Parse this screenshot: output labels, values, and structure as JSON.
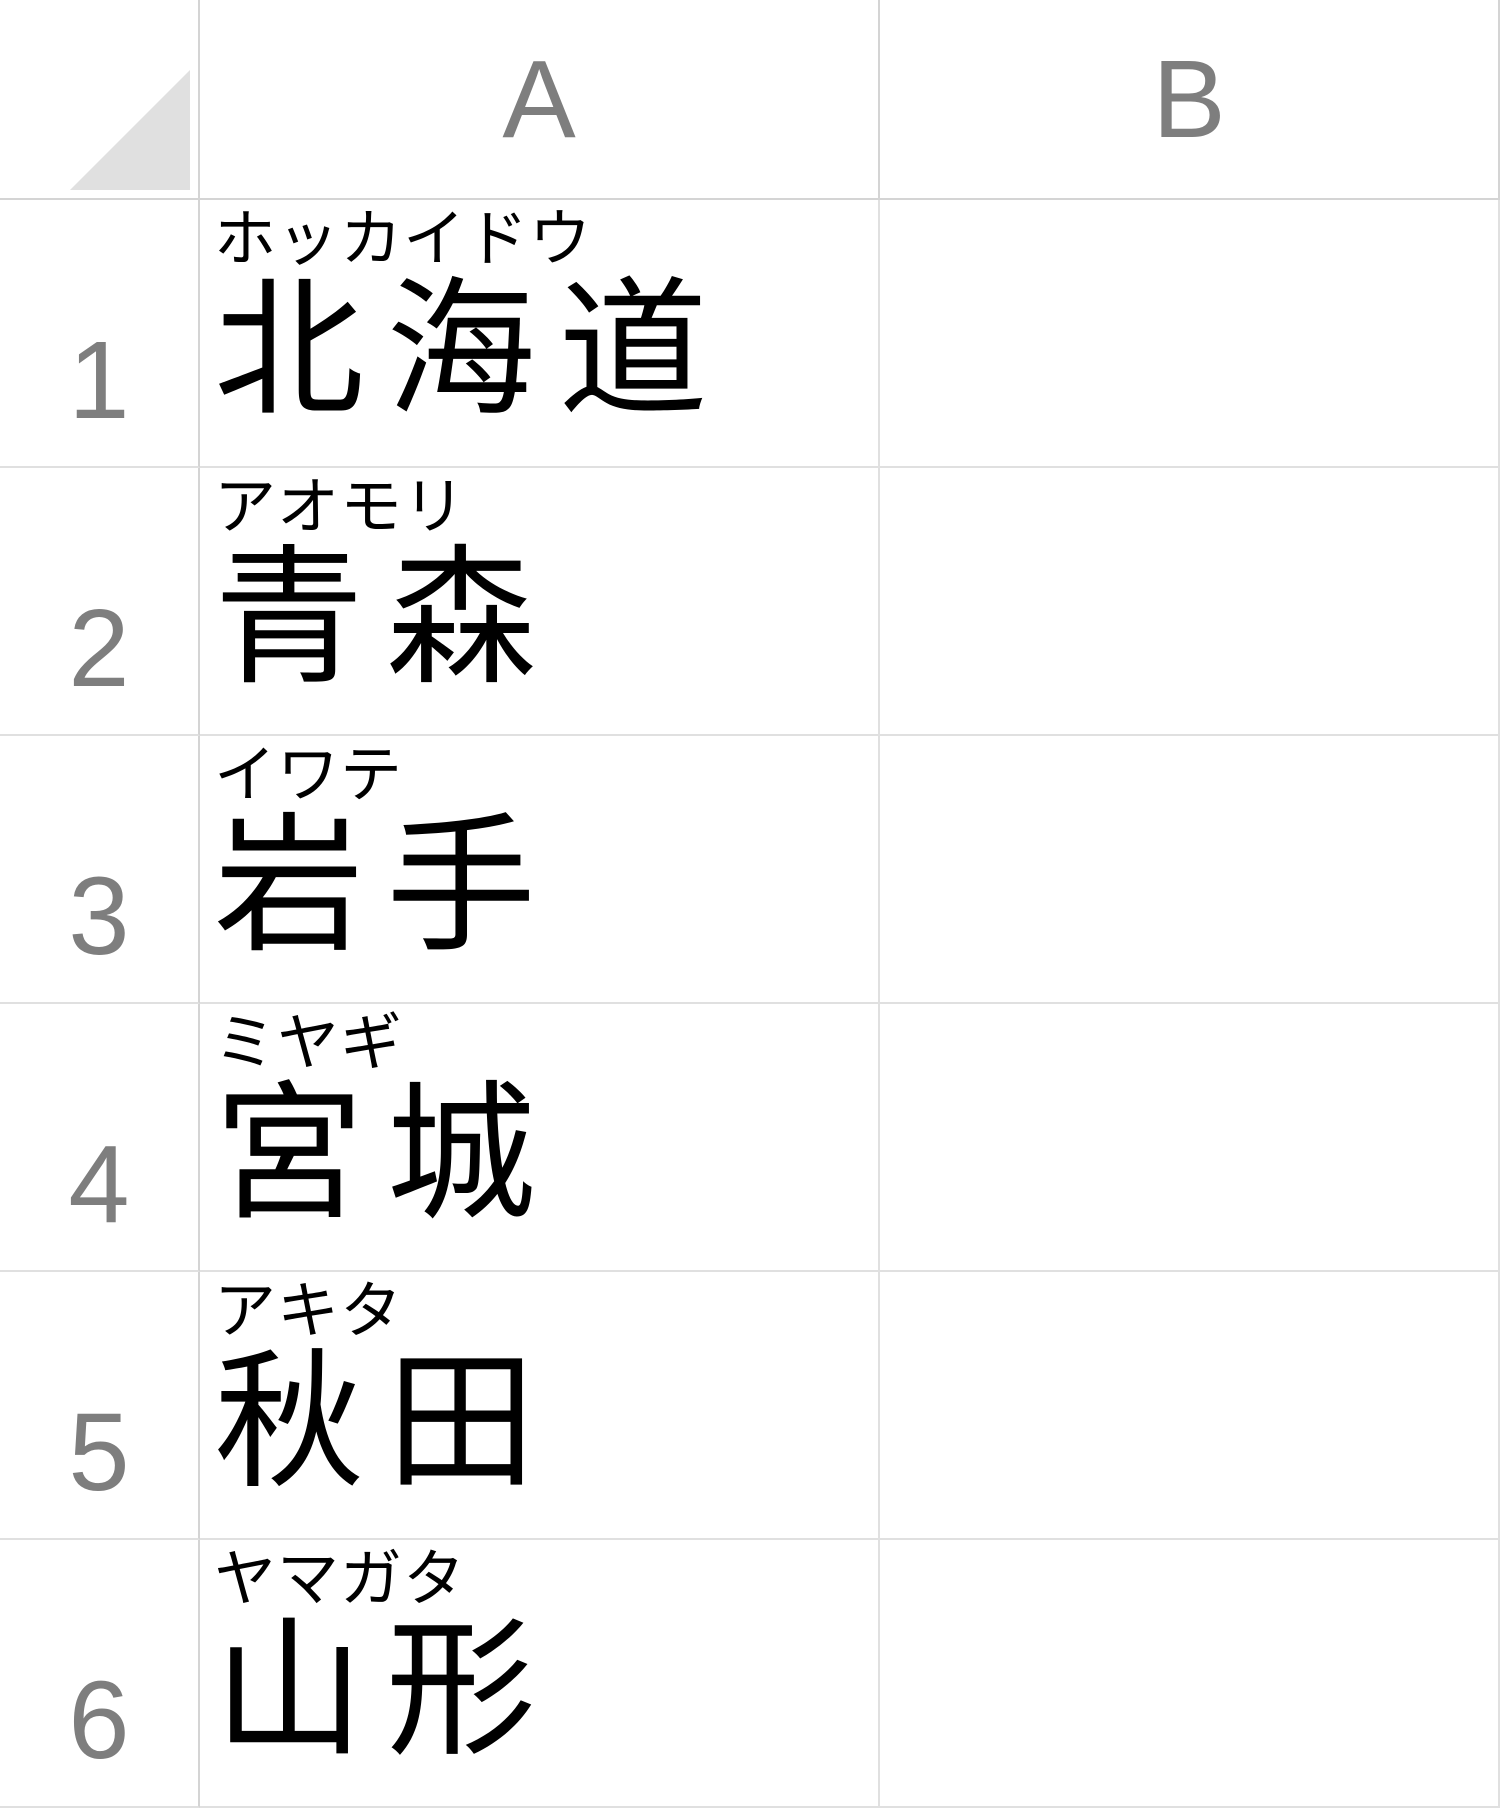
{
  "columns": {
    "A": "A",
    "B": "B"
  },
  "rows": [
    {
      "num": "1",
      "A": {
        "ruby": "ホッカイドウ",
        "text": "北海道"
      },
      "B": ""
    },
    {
      "num": "2",
      "A": {
        "ruby": "アオモリ",
        "text": "青森"
      },
      "B": ""
    },
    {
      "num": "3",
      "A": {
        "ruby": "イワテ",
        "text": "岩手"
      },
      "B": ""
    },
    {
      "num": "4",
      "A": {
        "ruby": "ミヤギ",
        "text": "宮城"
      },
      "B": ""
    },
    {
      "num": "5",
      "A": {
        "ruby": "アキタ",
        "text": "秋田"
      },
      "B": ""
    },
    {
      "num": "6",
      "A": {
        "ruby": "ヤマガタ",
        "text": "山形"
      },
      "B": ""
    }
  ]
}
